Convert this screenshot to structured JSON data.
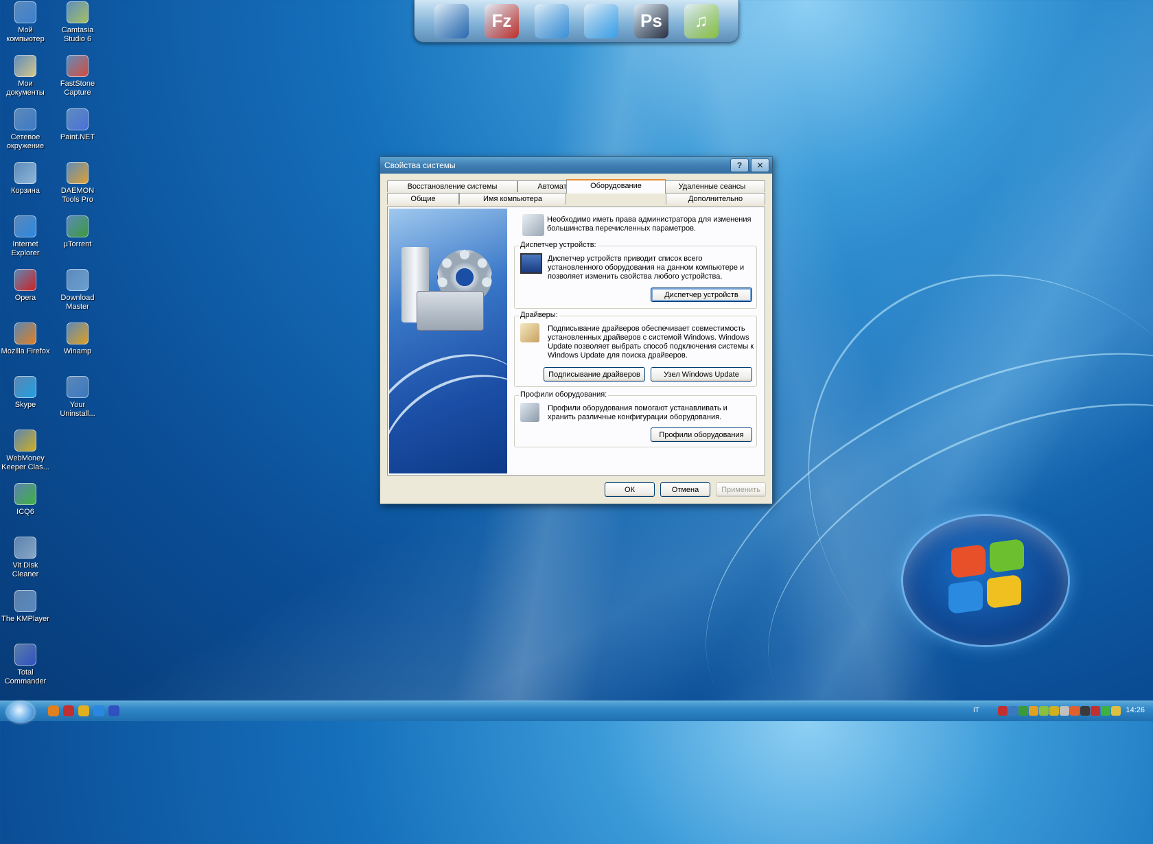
{
  "desktop": {
    "icons": [
      {
        "label": "Мой компьютер",
        "color": "#3a7fd0"
      },
      {
        "label": "Camtasia Studio 6",
        "color": "#a6c060"
      },
      {
        "label": "Мои документы",
        "color": "#d8c88a"
      },
      {
        "label": "FastStone Capture",
        "color": "#d84a3a"
      },
      {
        "label": "Сетевое окружение",
        "color": "#3d79c4"
      },
      {
        "label": "Paint.NET",
        "color": "#4a6fd8"
      },
      {
        "label": "Корзина",
        "color": "#8fb8d8"
      },
      {
        "label": "DAEMON Tools Pro",
        "color": "#e0a030"
      },
      {
        "label": "Internet Explorer",
        "color": "#2a88e0"
      },
      {
        "label": "µTorrent",
        "color": "#3a9a3a"
      },
      {
        "label": "Opera",
        "color": "#d02020"
      },
      {
        "label": "Download Master",
        "color": "#6aa0d0"
      },
      {
        "label": "Mozilla Firefox",
        "color": "#e08020"
      },
      {
        "label": "Winamp",
        "color": "#e0a020"
      },
      {
        "label": "Skype",
        "color": "#20a0e0"
      },
      {
        "label": "Your Uninstall...",
        "color": "#3a78c0"
      },
      {
        "label": "WebMoney Keeper Clas...",
        "color": "#d0b020"
      },
      {
        "label": "ICQ6",
        "color": "#40b040"
      },
      {
        "label": "Vit Disk Cleaner",
        "color": "#8aa8c8"
      },
      {
        "label": "The KMPlayer",
        "color": "#5a88c0"
      },
      {
        "label": "Total Commander",
        "color": "#3050c0"
      }
    ]
  },
  "dock": {
    "items": [
      {
        "name": "monitor",
        "glyph": "",
        "color": "#2a6ab0"
      },
      {
        "name": "filezilla",
        "glyph": "Fz",
        "color": "#c0302a"
      },
      {
        "name": "globe",
        "glyph": "",
        "color": "#3a90d8"
      },
      {
        "name": "arrow-up",
        "glyph": "",
        "color": "#3aa0e8"
      },
      {
        "name": "photoshop",
        "glyph": "Ps",
        "color": "#2a3040"
      },
      {
        "name": "audio",
        "glyph": "♫",
        "color": "#8ac040"
      }
    ]
  },
  "dialog": {
    "title": "Свойства системы",
    "help_glyph": "?",
    "close_glyph": "✕",
    "tabs_row1": [
      "Восстановление системы",
      "Автоматическое обновление",
      "Удаленные сеансы"
    ],
    "tabs_row2": [
      "Общие",
      "Имя компьютера",
      "Оборудование",
      "Дополнительно"
    ],
    "admin_note": "Необходимо иметь права администратора для изменения большинства перечисленных параметров.",
    "device_manager": {
      "title": "Диспетчер устройств:",
      "text": "Диспетчер устройств приводит список всего установленного оборудования на данном компьютере и позволяет изменить свойства любого устройства.",
      "button": "Диспетчер устройств"
    },
    "drivers": {
      "title": "Драйверы:",
      "text": "Подписывание драйверов обеспечивает совместимость установленных драйверов с системой Windows. Windows Update позволяет выбрать способ подключения системы к Windows Update для поиска драйверов.",
      "button_signing": "Подписывание драйверов",
      "button_update": "Узел Windows Update"
    },
    "profiles": {
      "title": "Профили оборудования:",
      "text": "Профили оборудования помогают устанавливать и хранить различные конфигурации оборудования.",
      "button": "Профили оборудования"
    },
    "ok": "ОК",
    "cancel": "Отмена",
    "apply": "Применить"
  },
  "taskbar": {
    "lang": "IT",
    "clock": "14:26",
    "quicklaunch_colors": [
      "#e08020",
      "#c03030",
      "#e0b020",
      "#2a88e0",
      "#3050c0"
    ],
    "tray_colors": [
      "#c03030",
      "#3a78c0",
      "#3a9a3a",
      "#e0a020",
      "#8ac040",
      "#d0b020",
      "#c0c0c0",
      "#e06030",
      "#3a3a3a",
      "#c03030",
      "#40b040",
      "#e0c040"
    ]
  }
}
